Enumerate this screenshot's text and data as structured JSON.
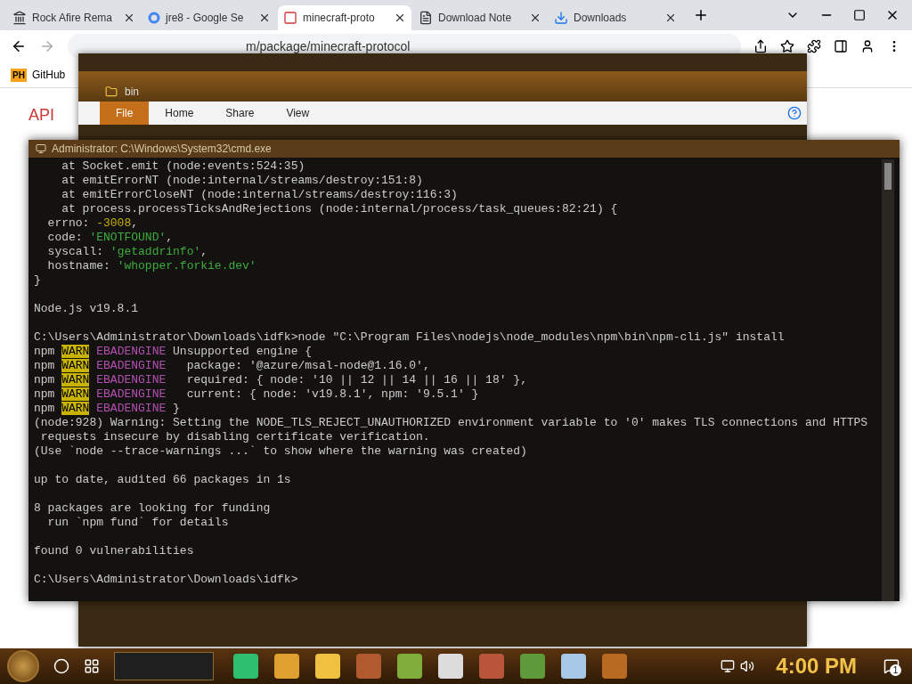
{
  "browser": {
    "tabs": [
      {
        "label": "Rock Afire Rema",
        "selected": false
      },
      {
        "label": "jre8 - Google Se",
        "selected": false
      },
      {
        "label": "minecraft-proto",
        "selected": true
      },
      {
        "label": "Download Note",
        "selected": false
      },
      {
        "label": "Downloads",
        "selected": false
      }
    ],
    "address": "m/package/minecraft-protocol",
    "bookmarks": [
      {
        "badge": "PH",
        "label": "GitHub"
      }
    ],
    "page_links": [
      "API"
    ]
  },
  "explorer": {
    "title": "bin",
    "ribbon_tabs": [
      {
        "label": "File",
        "selected": true
      },
      {
        "label": "Home",
        "selected": false
      },
      {
        "label": "Share",
        "selected": false
      },
      {
        "label": "View",
        "selected": false
      }
    ]
  },
  "terminal": {
    "title": "Administrator: C:\\Windows\\System32\\cmd.exe",
    "blocks": [
      [
        [
          {
            "kind": "plain",
            "text": "    at Socket.emit (node:events:524:35)"
          }
        ],
        [
          {
            "kind": "plain",
            "text": "    at emitErrorNT (node:internal/streams/destroy:151:8)"
          }
        ],
        [
          {
            "kind": "plain",
            "text": "    at emitErrorCloseNT (node:internal/streams/destroy:116:3)"
          }
        ],
        [
          {
            "kind": "plain",
            "text": "    at process.processTicksAndRejections (node:internal/process/task_queues:82:21) {"
          }
        ],
        [
          {
            "kind": "plain",
            "text": "  errno: "
          },
          {
            "kind": "number",
            "text": "-3008"
          },
          {
            "kind": "plain",
            "text": ","
          }
        ],
        [
          {
            "kind": "plain",
            "text": "  code: "
          },
          {
            "kind": "string",
            "text": "'ENOTFOUND'"
          },
          {
            "kind": "plain",
            "text": ","
          }
        ],
        [
          {
            "kind": "plain",
            "text": "  syscall: "
          },
          {
            "kind": "string",
            "text": "'getaddrinfo'"
          },
          {
            "kind": "plain",
            "text": ","
          }
        ],
        [
          {
            "kind": "plain",
            "text": "  hostname: "
          },
          {
            "kind": "string",
            "text": "'whopper.forkie.dev'"
          }
        ],
        [
          {
            "kind": "plain",
            "text": "}"
          }
        ]
      ],
      [
        [
          {
            "kind": "plain",
            "text": "Node.js v19.8.1"
          }
        ]
      ],
      [
        [
          {
            "kind": "plain",
            "text": "C:\\Users\\Administrator\\Downloads\\idfk>node \"C:\\Program Files\\nodejs\\node_modules\\npm\\bin\\npm-cli.js\" install"
          }
        ],
        [
          {
            "kind": "plain",
            "text": "npm "
          },
          {
            "kind": "warn",
            "text": "WARN"
          },
          {
            "kind": "tag",
            "text": " EBADENGINE"
          },
          {
            "kind": "plain",
            "text": " Unsupported engine {"
          }
        ],
        [
          {
            "kind": "plain",
            "text": "npm "
          },
          {
            "kind": "warn",
            "text": "WARN"
          },
          {
            "kind": "tag",
            "text": " EBADENGINE"
          },
          {
            "kind": "plain",
            "text": "   package: '@azure/msal-node@1.16.0',"
          }
        ],
        [
          {
            "kind": "plain",
            "text": "npm "
          },
          {
            "kind": "warn",
            "text": "WARN"
          },
          {
            "kind": "tag",
            "text": " EBADENGINE"
          },
          {
            "kind": "plain",
            "text": "   required: { node: '10 || 12 || 14 || 16 || 18' },"
          }
        ],
        [
          {
            "kind": "plain",
            "text": "npm "
          },
          {
            "kind": "warn",
            "text": "WARN"
          },
          {
            "kind": "tag",
            "text": " EBADENGINE"
          },
          {
            "kind": "plain",
            "text": "   current: { node: 'v19.8.1', npm: '9.5.1' }"
          }
        ],
        [
          {
            "kind": "plain",
            "text": "npm "
          },
          {
            "kind": "warn",
            "text": "WARN"
          },
          {
            "kind": "tag",
            "text": " EBADENGINE"
          },
          {
            "kind": "plain",
            "text": " }"
          }
        ],
        [
          {
            "kind": "plain",
            "text": "(node:928) Warning: Setting the NODE_TLS_REJECT_UNAUTHORIZED environment variable to '0' makes TLS connections and HTTPS"
          }
        ],
        [
          {
            "kind": "plain",
            "text": " requests insecure by disabling certificate verification."
          }
        ],
        [
          {
            "kind": "plain",
            "text": "(Use `node --trace-warnings ...` to show where the warning was created)"
          }
        ]
      ],
      [
        [
          {
            "kind": "plain",
            "text": "up to date, audited 66 packages in 1s"
          }
        ]
      ],
      [
        [
          {
            "kind": "plain",
            "text": "8 packages are looking for funding"
          }
        ],
        [
          {
            "kind": "plain",
            "text": "  run `npm fund` for details"
          }
        ]
      ],
      [
        [
          {
            "kind": "plain",
            "text": "found 0 vulnerabilities"
          }
        ]
      ],
      [
        [
          {
            "kind": "plain",
            "text": "C:\\Users\\Administrator\\Downloads\\idfk>"
          }
        ]
      ]
    ]
  },
  "taskbar": {
    "apps": [
      {
        "kind": "chat"
      },
      {
        "kind": "chrome"
      },
      {
        "kind": "folder"
      },
      {
        "kind": "figure"
      },
      {
        "kind": "notepad"
      },
      {
        "kind": "paint"
      },
      {
        "kind": "box"
      },
      {
        "kind": "grass"
      },
      {
        "kind": "note"
      },
      {
        "kind": "radio"
      }
    ],
    "clock": "4:00 PM",
    "notifications": "1"
  }
}
